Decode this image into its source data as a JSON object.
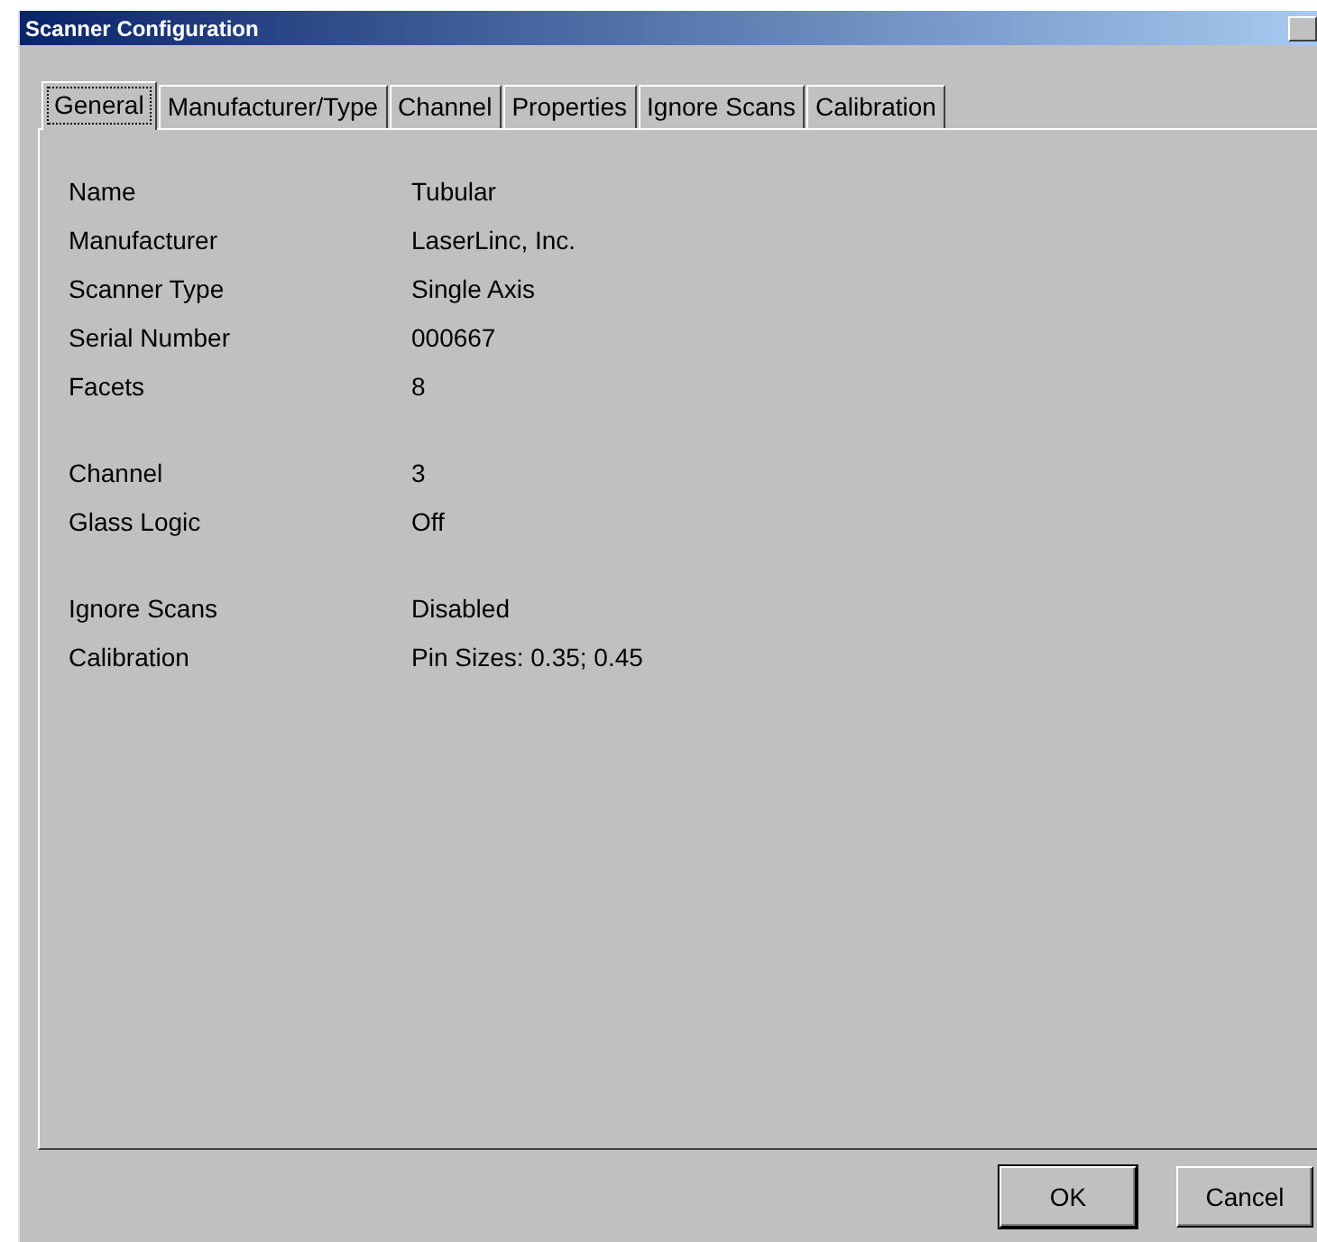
{
  "window": {
    "title": "Scanner Configuration"
  },
  "tabs": [
    {
      "label": "General",
      "selected": true
    },
    {
      "label": "Manufacturer/Type",
      "selected": false
    },
    {
      "label": "Channel",
      "selected": false
    },
    {
      "label": "Properties",
      "selected": false
    },
    {
      "label": "Ignore Scans",
      "selected": false
    },
    {
      "label": "Calibration",
      "selected": false
    }
  ],
  "groups": [
    [
      {
        "label": "Name",
        "value": "Tubular"
      },
      {
        "label": "Manufacturer",
        "value": "LaserLinc, Inc."
      },
      {
        "label": "Scanner Type",
        "value": "Single Axis"
      },
      {
        "label": "Serial Number",
        "value": "000667"
      },
      {
        "label": "Facets",
        "value": "8"
      }
    ],
    [
      {
        "label": "Channel",
        "value": "3"
      },
      {
        "label": "Glass Logic",
        "value": "Off"
      }
    ],
    [
      {
        "label": "Ignore Scans",
        "value": "Disabled"
      },
      {
        "label": "Calibration",
        "value": "Pin Sizes: 0.35; 0.45"
      }
    ]
  ],
  "buttons": [
    "OK",
    "Cancel"
  ]
}
